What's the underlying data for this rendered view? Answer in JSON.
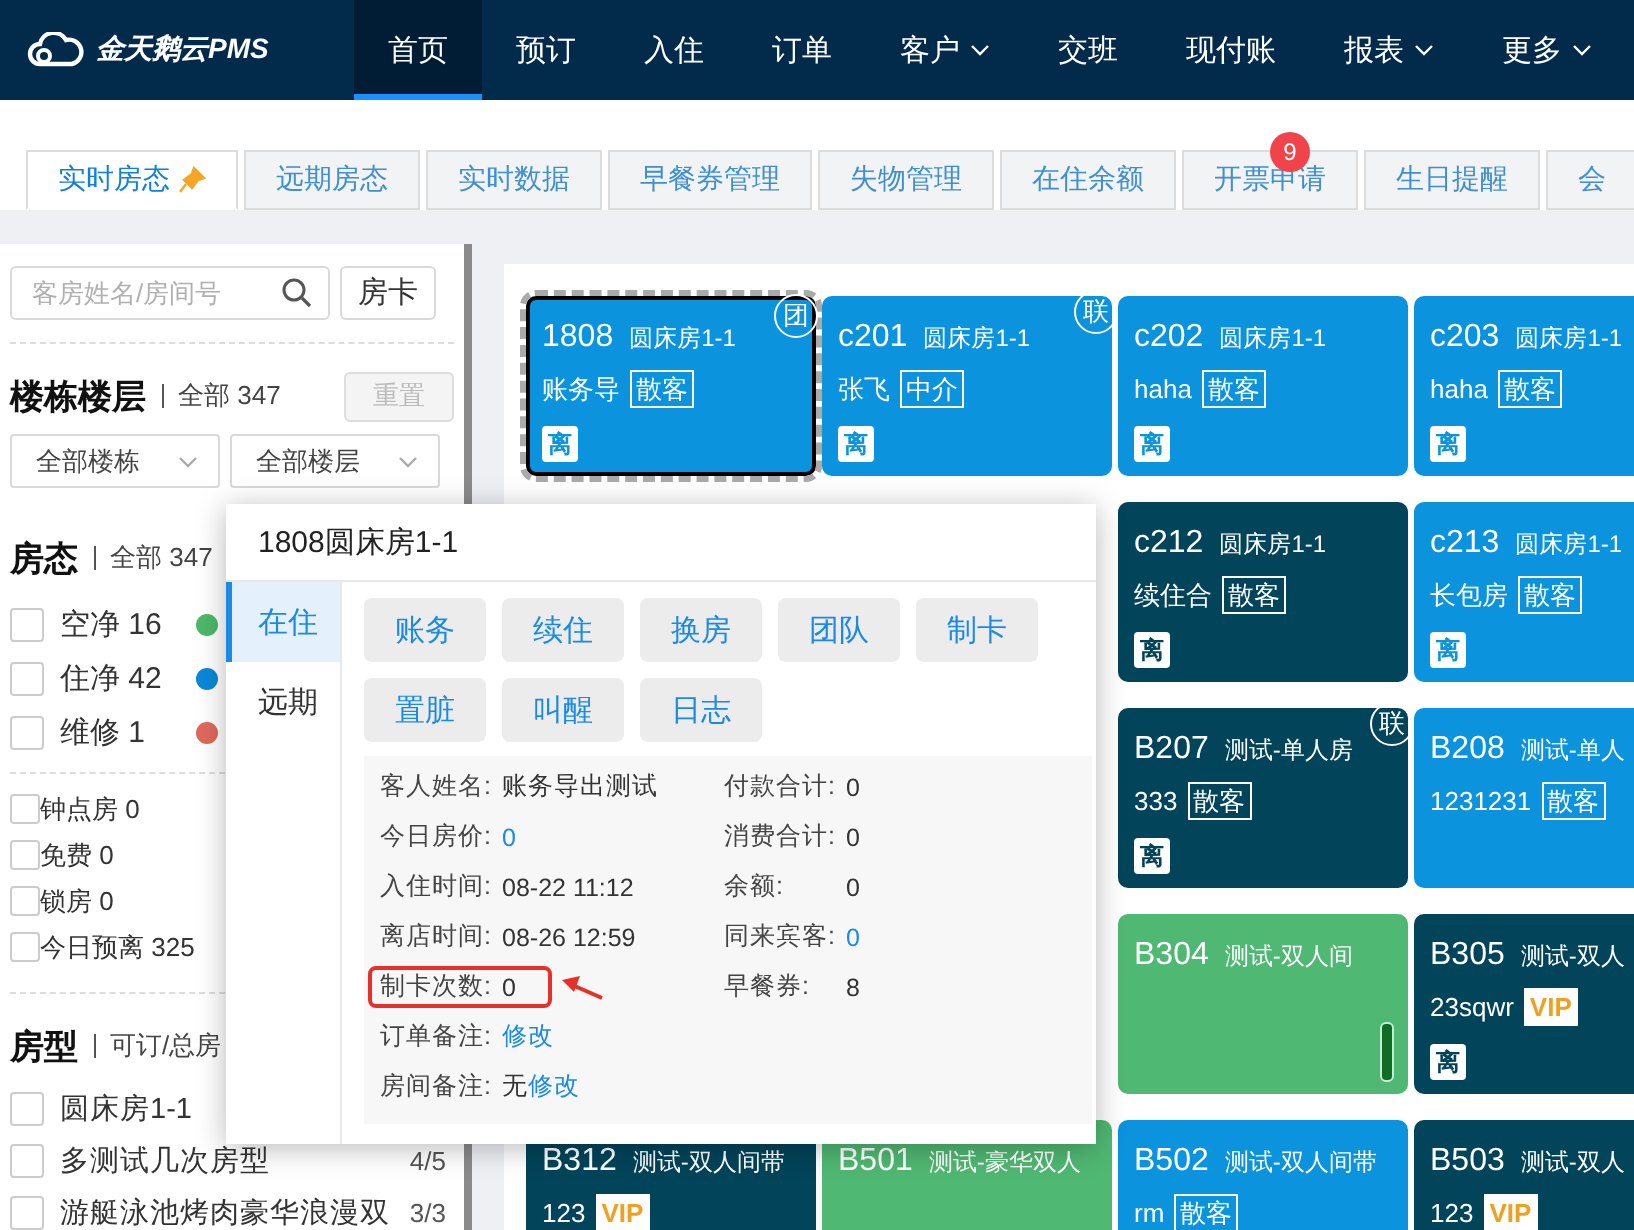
{
  "nav": {
    "logo": "金天鹅云PMS",
    "items": [
      {
        "label": "首页",
        "selected": true,
        "dropdown": false
      },
      {
        "label": "预订",
        "selected": false,
        "dropdown": false
      },
      {
        "label": "入住",
        "selected": false,
        "dropdown": false
      },
      {
        "label": "订单",
        "selected": false,
        "dropdown": false
      },
      {
        "label": "客户",
        "selected": false,
        "dropdown": true
      },
      {
        "label": "交班",
        "selected": false,
        "dropdown": false
      },
      {
        "label": "现付账",
        "selected": false,
        "dropdown": false
      },
      {
        "label": "报表",
        "selected": false,
        "dropdown": true
      },
      {
        "label": "更多",
        "selected": false,
        "dropdown": true
      }
    ]
  },
  "tabs": [
    {
      "label": "实时房态",
      "selected": true,
      "pinned": true
    },
    {
      "label": "远期房态",
      "selected": false,
      "pinned": false
    },
    {
      "label": "实时数据",
      "selected": false,
      "pinned": false
    },
    {
      "label": "早餐券管理",
      "selected": false,
      "pinned": false
    },
    {
      "label": "失物管理",
      "selected": false,
      "pinned": false
    },
    {
      "label": "在住余额",
      "selected": false,
      "pinned": false
    },
    {
      "label": "开票申请",
      "selected": false,
      "pinned": false,
      "badge": "9"
    },
    {
      "label": "生日提醒",
      "selected": false,
      "pinned": false
    },
    {
      "label": "会",
      "selected": false,
      "pinned": false
    }
  ],
  "sidebar": {
    "search": {
      "placeholder": "客房姓名/房间号"
    },
    "card_button": "房卡",
    "building_floor": {
      "title": "楼栋楼层",
      "summary": "全部 347",
      "reset": {
        "label": "重置",
        "disabled": true
      },
      "selects": [
        "全部楼栋",
        "全部楼层"
      ]
    },
    "room_status": {
      "title": "房态",
      "summary": "全部 347",
      "items": [
        {
          "label": "空净 16",
          "color": "#4cb86a",
          "checked": false
        },
        {
          "label": "住净 42",
          "color": "#0b88d8",
          "checked": false
        },
        {
          "label": "维修 1",
          "color": "#e0685e",
          "checked": false
        }
      ],
      "flags": [
        {
          "label": "钟点房 0",
          "checked": false
        },
        {
          "label": "免费 0",
          "checked": false
        },
        {
          "label": "锁房 0",
          "checked": false
        },
        {
          "label": "今日预离 325",
          "checked": false
        }
      ]
    },
    "room_types": {
      "title": "房型",
      "summary": "可订/总房",
      "items": [
        {
          "label": "圆床房1-1",
          "checked": false
        },
        {
          "label": "多测试几次房型",
          "count": "4/5",
          "checked": false
        },
        {
          "label": "游艇泳池烤肉豪华浪漫双",
          "count": "3/3",
          "checked": false
        }
      ]
    }
  },
  "rooms": {
    "rows": [
      [
        {
          "number": "1808",
          "type": "圆床房1-1",
          "guest": "账务导",
          "tag": {
            "text": "散客",
            "kind": "plain"
          },
          "badge": "离",
          "corner": "团",
          "color": "#0b93de",
          "selected": true,
          "indicator": false
        },
        {
          "number": "c201",
          "type": "圆床房1-1",
          "guest": "张飞",
          "tag": {
            "text": "中介",
            "kind": "plain"
          },
          "badge": "离",
          "corner": "联",
          "color": "#0b93de",
          "selected": false,
          "indicator": false
        },
        {
          "number": "c202",
          "type": "圆床房1-1",
          "guest": "haha",
          "tag": {
            "text": "散客",
            "kind": "plain"
          },
          "badge": "离",
          "color": "#0b93de",
          "selected": false,
          "indicator": false
        },
        {
          "number": "c203",
          "type": "圆床房1-1",
          "guest": "haha",
          "tag": {
            "text": "散客",
            "kind": "plain"
          },
          "badge": "离",
          "color": "#0b93de",
          "selected": false,
          "indicator": false
        }
      ],
      [
        {
          "number": "c212",
          "type": "圆床房1-1",
          "guest": "续住合",
          "tag": {
            "text": "散客",
            "kind": "plain"
          },
          "badge": "离",
          "color": "#02445a",
          "selected": false,
          "indicator": false
        },
        {
          "number": "c213",
          "type": "圆床房1-1",
          "guest": "长包房",
          "tag": {
            "text": "散客",
            "kind": "plain"
          },
          "badge": "离",
          "color": "#0b93de",
          "selected": false,
          "indicator": false
        }
      ],
      [
        {
          "number": "B207",
          "type": "测试-单人房",
          "guest": "333",
          "tag": {
            "text": "散客",
            "kind": "plain"
          },
          "badge": "离",
          "corner": "联",
          "color": "#02445a",
          "selected": false,
          "indicator": false
        },
        {
          "number": "B208",
          "type": "测试-单人",
          "guest": "1231231",
          "tag": {
            "text": "散客",
            "kind": "plain"
          },
          "color": "#0b93de",
          "selected": false,
          "indicator": false
        }
      ],
      [
        {
          "number": "B304",
          "type": "测试-双人间",
          "color": "#4fb872",
          "selected": false,
          "indicator": true
        },
        {
          "number": "B305",
          "type": "测试-双人",
          "guest": "23sqwr",
          "tag": {
            "text": "VIP",
            "kind": "vip"
          },
          "badge": "离",
          "color": "#02445a",
          "selected": false,
          "indicator": false
        }
      ],
      [
        {
          "number": "B312",
          "type": "测试-双人间带",
          "guest": "123",
          "tag": {
            "text": "VIP",
            "kind": "vip"
          },
          "color": "#02445a",
          "selected": false,
          "indicator": false
        },
        {
          "number": "B501",
          "type": "测试-豪华双人",
          "color": "#4fb872",
          "selected": false,
          "indicator": false
        },
        {
          "number": "B502",
          "type": "测试-双人间带",
          "guest": "rm",
          "tag": {
            "text": "散客",
            "kind": "plain"
          },
          "color": "#0b93de",
          "selected": false,
          "indicator": false
        },
        {
          "number": "B503",
          "type": "测试-双人",
          "guest": "123",
          "tag": {
            "text": "VIP",
            "kind": "vip"
          },
          "color": "#02445a",
          "selected": false,
          "indicator": false
        }
      ]
    ]
  },
  "popup": {
    "title": "1808圆床房1-1",
    "tabs": [
      {
        "label": "在住",
        "selected": true
      },
      {
        "label": "远期",
        "selected": false
      }
    ],
    "actions": [
      "账务",
      "续住",
      "换房",
      "团队",
      "制卡",
      "置脏",
      "叫醒",
      "日志"
    ],
    "columns": [
      [
        {
          "label": "客人姓名:",
          "value": "账务导出测试",
          "highlighted": false
        },
        {
          "label": "今日房价:",
          "link_value": "0",
          "highlighted": false
        },
        {
          "label": "入住时间:",
          "value": "08-22 11:12",
          "highlighted": false
        },
        {
          "label": "离店时间:",
          "value": "08-26 12:59",
          "highlighted": false
        },
        {
          "label": "制卡次数:",
          "value": "0",
          "highlighted": true
        },
        {
          "label": "订单备注:",
          "action": "修改",
          "highlighted": false
        },
        {
          "label": "房间备注:",
          "value": "无",
          "action": "修改",
          "highlighted": false
        }
      ],
      [
        {
          "label": "付款合计:",
          "value": "0",
          "highlighted": false
        },
        {
          "label": "消费合计:",
          "value": "0",
          "highlighted": false
        },
        {
          "label": "余额:",
          "value": "0",
          "highlighted": false
        },
        {
          "label": "同来宾客:",
          "link_value": "0",
          "highlighted": false
        },
        {
          "label": "早餐券:",
          "value": "8",
          "highlighted": false
        }
      ]
    ]
  }
}
